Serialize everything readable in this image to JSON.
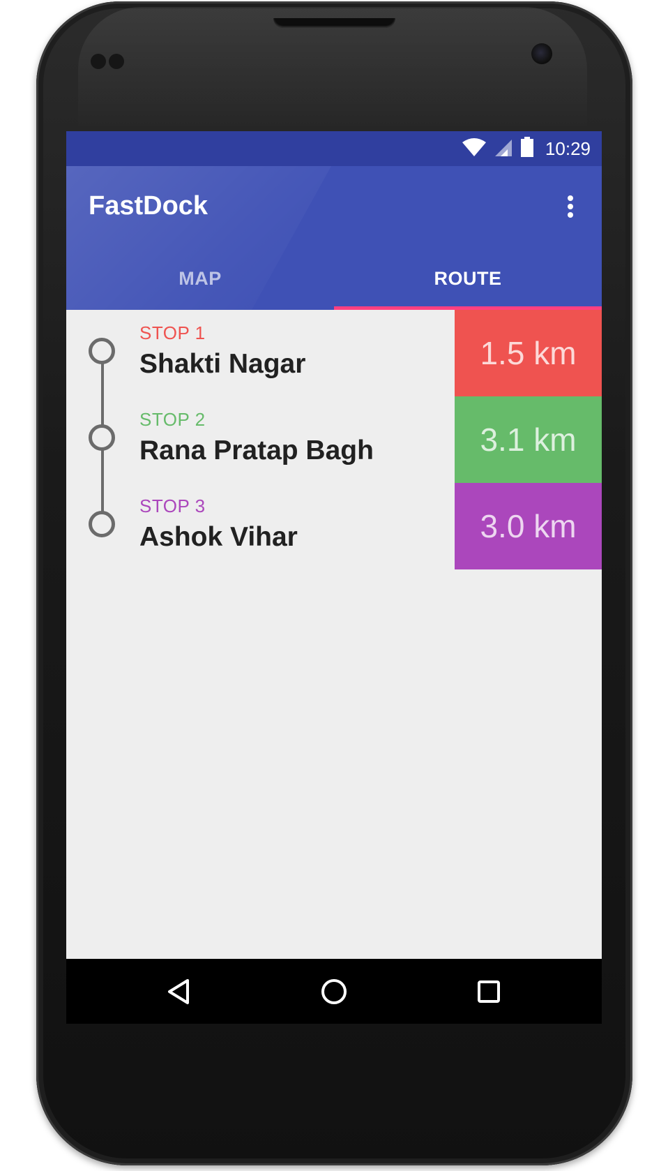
{
  "status_bar": {
    "time": "10:29",
    "icons": [
      "wifi-icon",
      "cell-signal-icon",
      "battery-icon"
    ]
  },
  "app_bar": {
    "title": "FastDock",
    "menu_icon": "overflow-menu-icon"
  },
  "tabs": [
    {
      "label": "MAP",
      "active": false
    },
    {
      "label": "ROUTE",
      "active": true
    }
  ],
  "stops": [
    {
      "label": "STOP 1",
      "name": "Shakti Nagar",
      "distance": "1.5 km",
      "color": "#ef5350"
    },
    {
      "label": "STOP 2",
      "name": "Rana Pratap Bagh",
      "distance": "3.1 km",
      "color": "#66bb6a"
    },
    {
      "label": "STOP 3",
      "name": "Ashok Vihar",
      "distance": "3.0 km",
      "color": "#ab47bc"
    }
  ],
  "nav_bar": {
    "icons": [
      "back-icon",
      "home-icon",
      "recents-icon"
    ]
  },
  "theme": {
    "primary": "#3f51b5",
    "primary_dark": "#303f9f",
    "accent": "#ff4081",
    "background": "#eeeeee"
  }
}
